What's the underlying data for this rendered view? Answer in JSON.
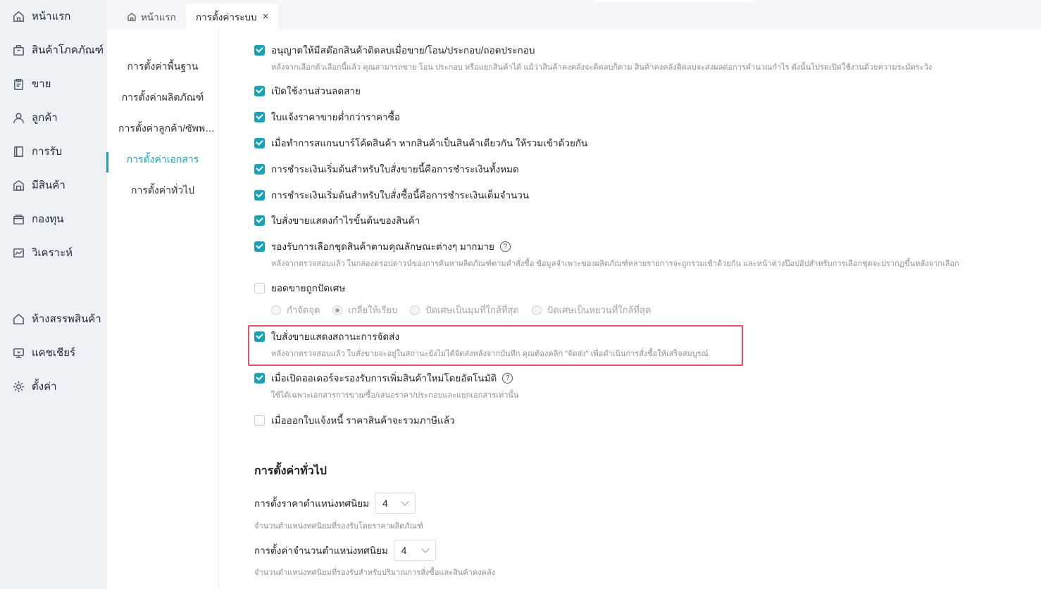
{
  "sidebar": {
    "items": [
      {
        "label": "หน้าแรก",
        "icon": "home-icon"
      },
      {
        "label": "สินค้าโภคภัณฑ์",
        "icon": "box-icon"
      },
      {
        "label": "ขาย",
        "icon": "clipboard-icon"
      },
      {
        "label": "ลูกค้า",
        "icon": "user-icon"
      },
      {
        "label": "การรับ",
        "icon": "receive-icon"
      },
      {
        "label": "มีสินค้า",
        "icon": "warehouse-icon"
      },
      {
        "label": "กองทุน",
        "icon": "wallet-icon"
      },
      {
        "label": "วิเคราะห์",
        "icon": "chart-icon"
      },
      {
        "label": "ห้างสรรพสินค้า",
        "icon": "store-icon"
      },
      {
        "label": "แคชเชียร์",
        "icon": "cashier-icon"
      },
      {
        "label": "ตั้งค่า",
        "icon": "gear-icon"
      }
    ]
  },
  "tabs": [
    {
      "label": "หน้าแรก"
    },
    {
      "label": "การตั้งค่าระบบ",
      "close": "×"
    }
  ],
  "subnav": {
    "items": [
      {
        "label": "การตั้งค่าพื้นฐาน"
      },
      {
        "label": "การตั้งค่าผลิตภัณฑ์"
      },
      {
        "label": "การตั้งค่าลูกค้า/ซัพพลายเออร์"
      },
      {
        "label": "การตั้งค่าเอกสาร"
      },
      {
        "label": "การตั้งค่าทั่วไป"
      }
    ],
    "active_index": 3
  },
  "options": [
    {
      "label": "อนุญาตให้มีสต๊อกสินค้าติดลบเมื่อขาย/โอน/ประกอบ/ถอดประกอบ",
      "checked": true,
      "desc": "หลังจากเลือกตัวเลือกนี้แล้ว คุณสามารถขาย โอน ประกอบ หรือแยกสินค้าได้ แม้ว่าสินค้าคงคลังจะติดลบก็ตาม สินค้าคงคลังติดลบจะส่งผลต่อการคำนวณกำไร ดังนั้นโปรดเปิดใช้งานด้วยความระมัดระวัง"
    },
    {
      "label": "เปิดใช้งานส่วนลดสาย",
      "checked": true
    },
    {
      "label": "ใบแจ้งราคาขายต่ำกว่าราคาซื้อ",
      "checked": true
    },
    {
      "label": "เมื่อทำการสแกนบาร์โค้ดสินค้า หากสินค้าเป็นสินค้าเดียวกัน ให้รวมเข้าด้วยกัน",
      "checked": true
    },
    {
      "label": "การชำระเงินเริ่มต้นสำหรับใบสั่งขายนี้คือการชำระเงินทั้งหมด",
      "checked": true
    },
    {
      "label": "การชำระเงินเริ่มต้นสำหรับใบสั่งซื้อนี้คือการชำระเงินเต็มจำนวน",
      "checked": true
    },
    {
      "label": "ใบสั่งขายแสดงกำไรขั้นต้นของสินค้า",
      "checked": true
    },
    {
      "label": "รองรับการเลือกชุดสินค้าตามคุณลักษณะต่างๆ มากมาย",
      "checked": true,
      "help": "?",
      "desc": "หลังจากตรวจสอบแล้ว ในกล่องดรอปดาวน์ของการค้นหาผลิตภัณฑ์ตามคำสั่งซื้อ ข้อมูลจำเพาะของผลิตภัณฑ์หลายรายการจะถูกรวมเข้าด้วยกัน และหน้าต่างป๊อปอัปสำหรับการเลือกชุดจะปรากฏขึ้นหลังจากเลือก"
    },
    {
      "label": "ยอดขายถูกปัดเศษ",
      "checked": false
    },
    {
      "label": "ใบสั่งขายแสดงสถานะการจัดส่ง",
      "checked": true,
      "desc": "หลังจากตรวจสอบแล้ว ใบสั่งขายจะอยู่ในสถานะยังไม่ได้จัดส่งหลังจากบันทึก คุณต้องคลิก \"จัดส่ง\" เพื่อดำเนินการสั่งซื้อให้เสร็จสมบูรณ์"
    },
    {
      "label": "เมื่อเปิดออเดอร์จะรองรับการเพิ่มสินค้าใหม่โดยอัตโนมัติ",
      "checked": true,
      "help": "?",
      "desc": "ใช้ได้เฉพาะเอกสารการขาย/ซื้อ/เสนอราคา/ประกอบและแยกเอกสารเท่านั้น"
    },
    {
      "label": "เมื่อออกใบแจ้งหนี้ ราคาสินค้าจะรวมภาษีแล้ว",
      "checked": false
    }
  ],
  "rounding": {
    "options": [
      "กำจัดจุด",
      "เกลี่ยให้เรียบ",
      "ปัดเศษเป็นมุมที่ใกล้ที่สุด",
      "ปัดเศษเป็นหยวนที่ใกล้ที่สุด"
    ],
    "selected_index": 1
  },
  "general": {
    "title": "การตั้งค่าทั่วไป",
    "price_decimal": {
      "label": "การตั้งราคาตำแหน่งทศนิยม",
      "value": "4",
      "desc": "จำนวนตำแหน่งทศนิยมที่รองรับโดยราคาผลิตภัณฑ์"
    },
    "qty_decimal": {
      "label": "การตั้งค่าจำนวนตำแหน่งทศนิยม",
      "value": "4",
      "desc": "จำนวนตำแหน่งทศนิยมที่รองรับสำหรับปริมาณการสั่งซื้อและสินค้าคงคลัง"
    }
  },
  "colors": {
    "accent": "#17a2b8",
    "highlight_border": "#e35067"
  }
}
